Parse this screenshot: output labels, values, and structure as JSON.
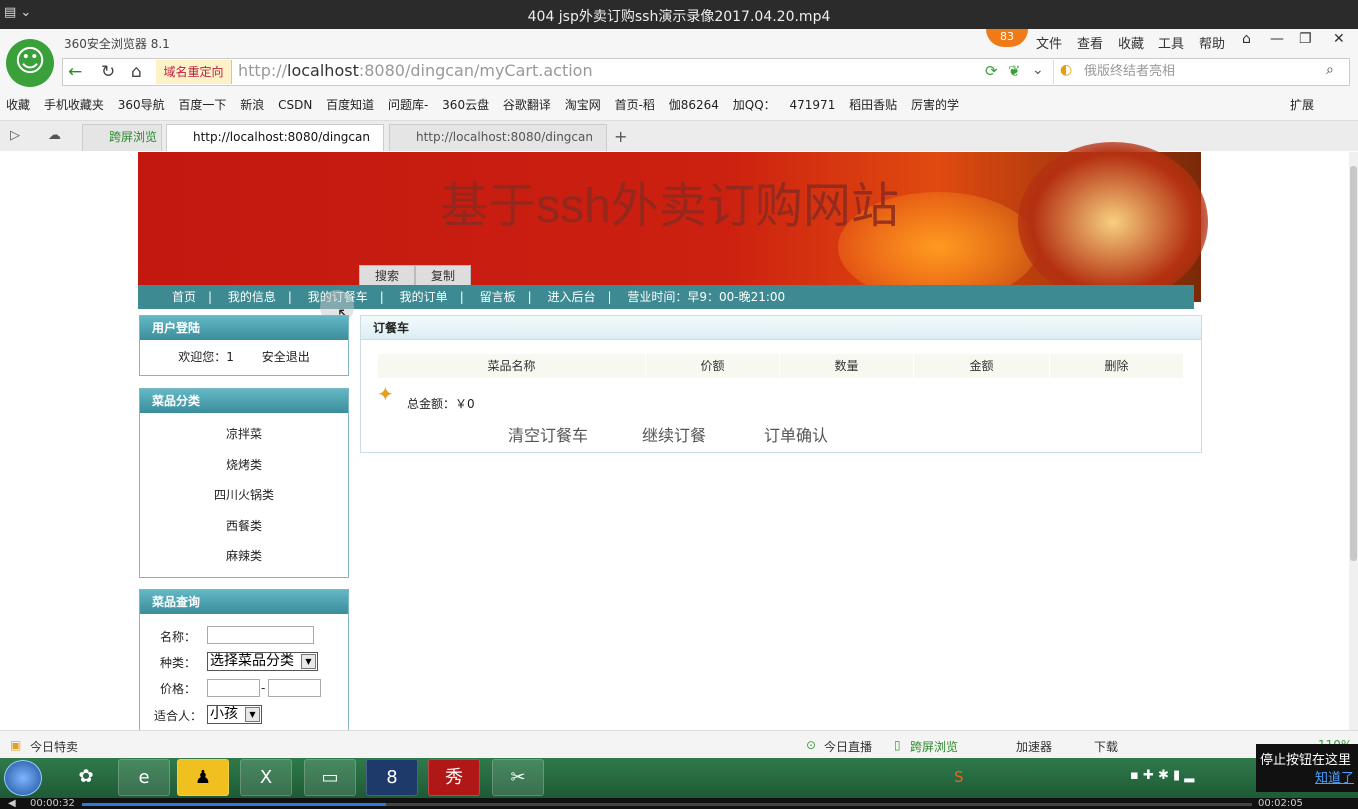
{
  "window": {
    "title": "404 jsp外卖订购ssh演示录像2017.04.20.mp4"
  },
  "browser": {
    "brand": "360安全浏览器 8.1",
    "badge": "83",
    "menus": [
      "文件",
      "查看",
      "收藏",
      "工具",
      "帮助"
    ],
    "redirect_label": "域名重定向",
    "url_prefix": "http://",
    "url_host": "localhost",
    "url_rest": ":8080/dingcan/myCart.action",
    "search_placeholder": "俄版终结者亮相",
    "bookmarks": [
      "收藏",
      "手机收藏夹",
      "360导航",
      "百度一下",
      "新浪",
      "CSDN",
      "百度知道",
      "问题库-",
      "360云盘",
      "谷歌翻译",
      "淘宝网",
      "首页-稻",
      "伽86264",
      "加QQ：",
      "471971",
      "稻田香贴",
      "厉害的学"
    ],
    "extension_label": "扩展",
    "tabs": [
      {
        "label": "跨屏浏览"
      },
      {
        "label": "http://localhost:8080/dingcan"
      },
      {
        "label": "http://localhost:8080/dingcan"
      }
    ]
  },
  "site": {
    "banner_title": "基于ssh外卖订购网站",
    "popup_buttons": [
      "搜索",
      "复制"
    ],
    "nav": [
      "首页",
      "我的信息",
      "我的订餐车",
      "我的订单",
      "留言板",
      "进入后台",
      "营业时间：早9：00-晚21:00"
    ]
  },
  "login": {
    "title": "用户登陆",
    "welcome": "欢迎您：1",
    "logout": "安全退出"
  },
  "categories": {
    "title": "菜品分类",
    "items": [
      "凉拌菜",
      "烧烤类",
      "四川火锅类",
      "西餐类",
      "麻辣类"
    ]
  },
  "query": {
    "title": "菜品查询",
    "name_label": "名称：",
    "type_label": "种类：",
    "type_selected": "选择菜品分类",
    "price_label": "价格：",
    "price_sep": "-",
    "audience_label": "适合人：",
    "audience_selected": "小孩"
  },
  "cart": {
    "title": "订餐车",
    "columns": [
      "菜品名称",
      "价额",
      "数量",
      "金额",
      "删除"
    ],
    "total": "总金额：￥0",
    "actions": [
      "清空订餐车",
      "继续订餐",
      "订单确认"
    ]
  },
  "statusbar": {
    "left": "今日特卖",
    "items": [
      "今日直播",
      "跨屏浏览",
      "加速器",
      "下载"
    ],
    "zoom": "110%"
  },
  "player": {
    "elapsed": "00:00:32",
    "total": "00:02:05",
    "progress": 0.26
  },
  "notice": {
    "text": "停止按钮在这里",
    "link": "知道了"
  }
}
